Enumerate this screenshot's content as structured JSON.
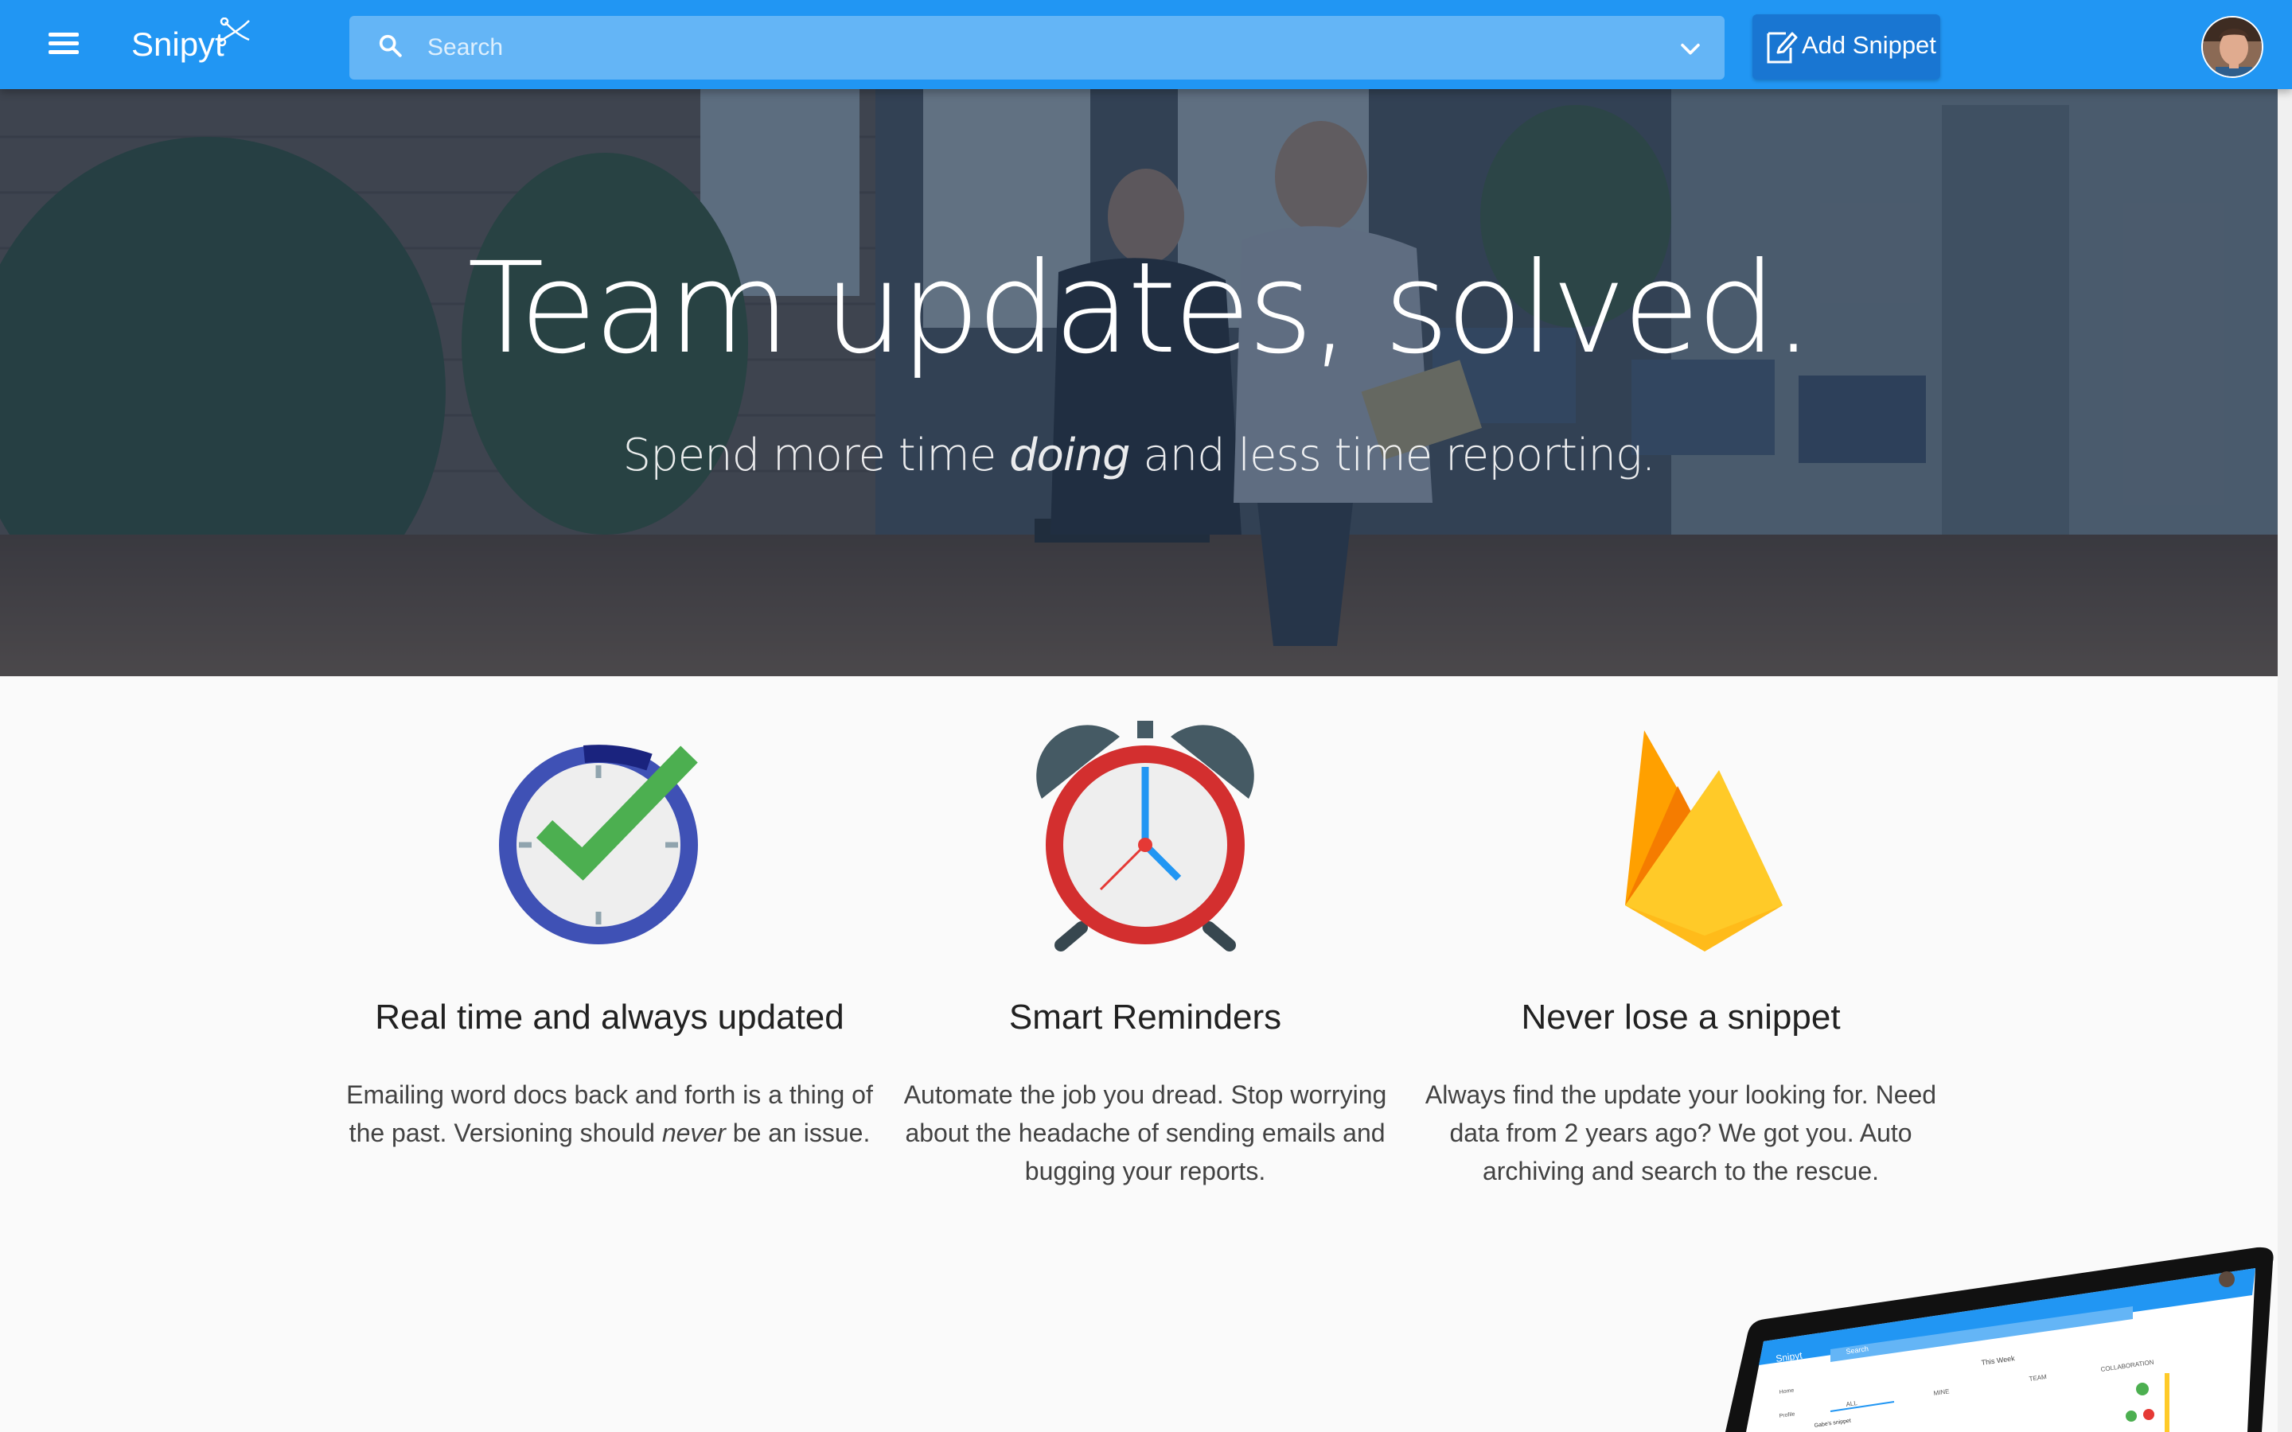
{
  "app": {
    "brand": "Snipyt"
  },
  "header": {
    "search_placeholder": "Search",
    "add_snippet_label": "Add Snippet"
  },
  "hero": {
    "title": "Team updates, solved.",
    "subtitle_before": "Spend more time ",
    "subtitle_em": "doing",
    "subtitle_after": " and less time reporting."
  },
  "features": [
    {
      "icon": "clock-check-icon",
      "title": "Real time and always updated",
      "text_before": "Emailing word docs back and forth is a thing of the past. Versioning should ",
      "text_em": "never",
      "text_after": " be an issue."
    },
    {
      "icon": "alarm-clock-icon",
      "title": "Smart Reminders",
      "text": "Automate the job you dread. Stop worrying about the headache of sending emails and bugging your reports."
    },
    {
      "icon": "firebase-flame-icon",
      "title": "Never lose a snippet",
      "text": "Always find the update your looking for. Need data from 2 years ago? We got you. Auto archiving and search to the rescue."
    }
  ],
  "preview": {
    "brand": "Snipyt",
    "search": "Search",
    "week": "This Week",
    "tabs": [
      "ALL",
      "MINE",
      "TEAM",
      "COLLABORATION"
    ],
    "nav": [
      "Home",
      "Profile"
    ],
    "row": "Gabe's snippet"
  },
  "colors": {
    "primary": "#2196f3",
    "primary_dark": "#1976d2",
    "search_bg": "#64b5f6"
  }
}
